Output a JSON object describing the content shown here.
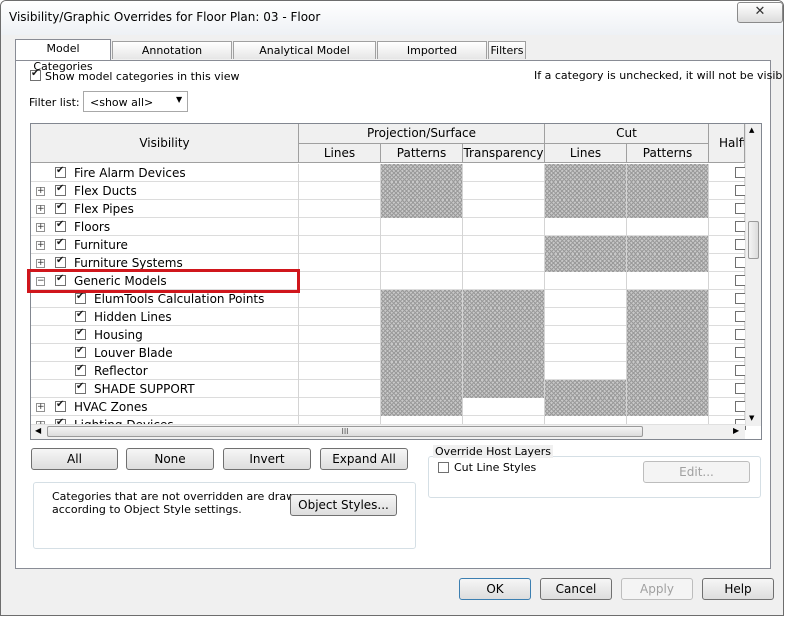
{
  "window": {
    "title": "Visibility/Graphic Overrides for Floor Plan: 03 - Floor",
    "close_glyph": "✕"
  },
  "tabs": [
    {
      "label": "Model Categories",
      "active": true
    },
    {
      "label": "Annotation Categories"
    },
    {
      "label": "Analytical Model Categories"
    },
    {
      "label": "Imported Categories"
    },
    {
      "label": "Filters"
    }
  ],
  "show_model": {
    "label": "Show model categories in this view",
    "checked": true
  },
  "hint": "If a category is unchecked, it will not be visible.",
  "filter": {
    "label": "Filter list:",
    "value": "<show all>"
  },
  "grid": {
    "headers": {
      "visibility": "Visibility",
      "projection": "Projection/Surface",
      "cut": "Cut",
      "halftone": "Halftone",
      "lines": "Lines",
      "patterns": "Patterns",
      "transparency": "Transparency",
      "cut_lines": "Lines",
      "cut_patterns": "Patterns"
    },
    "rows": [
      {
        "name": "Fire Alarm Devices",
        "level": 0,
        "expander": "",
        "checked": true,
        "hatch": [
          false,
          true,
          false,
          true,
          true
        ]
      },
      {
        "name": "Flex Ducts",
        "level": 0,
        "expander": "+",
        "checked": true,
        "hatch": [
          false,
          true,
          false,
          true,
          true
        ]
      },
      {
        "name": "Flex Pipes",
        "level": 0,
        "expander": "+",
        "checked": true,
        "hatch": [
          false,
          true,
          false,
          true,
          true
        ]
      },
      {
        "name": "Floors",
        "level": 0,
        "expander": "+",
        "checked": true,
        "hatch": [
          false,
          false,
          false,
          false,
          false
        ]
      },
      {
        "name": "Furniture",
        "level": 0,
        "expander": "+",
        "checked": true,
        "hatch": [
          false,
          false,
          false,
          true,
          true
        ]
      },
      {
        "name": "Furniture Systems",
        "level": 0,
        "expander": "+",
        "checked": true,
        "hatch": [
          false,
          false,
          false,
          true,
          true
        ]
      },
      {
        "name": "Generic Models",
        "level": 0,
        "expander": "−",
        "checked": true,
        "hatch": [
          false,
          false,
          false,
          false,
          false
        ]
      },
      {
        "name": "ElumTools Calculation Points",
        "level": 1,
        "expander": "",
        "checked": true,
        "hatch": [
          false,
          true,
          true,
          false,
          true
        ]
      },
      {
        "name": "Hidden Lines",
        "level": 1,
        "expander": "",
        "checked": true,
        "hatch": [
          false,
          true,
          true,
          false,
          true
        ]
      },
      {
        "name": "Housing",
        "level": 1,
        "expander": "",
        "checked": true,
        "hatch": [
          false,
          true,
          true,
          false,
          true
        ]
      },
      {
        "name": "Louver Blade",
        "level": 1,
        "expander": "",
        "checked": true,
        "hatch": [
          false,
          true,
          true,
          false,
          true
        ]
      },
      {
        "name": "Reflector",
        "level": 1,
        "expander": "",
        "checked": true,
        "hatch": [
          false,
          true,
          true,
          false,
          true
        ]
      },
      {
        "name": "SHADE SUPPORT",
        "level": 1,
        "expander": "",
        "checked": true,
        "hatch": [
          false,
          true,
          true,
          true,
          true
        ]
      },
      {
        "name": "HVAC Zones",
        "level": 0,
        "expander": "+",
        "checked": true,
        "hatch": [
          false,
          true,
          false,
          true,
          true
        ]
      },
      {
        "name": "Lighting Devices",
        "level": 0,
        "expander": "+",
        "checked": true,
        "hatch": [
          false,
          false,
          false,
          false,
          false
        ]
      }
    ]
  },
  "buttons": {
    "all": "All",
    "none": "None",
    "invert": "Invert",
    "expand_all": "Expand All",
    "object_styles": "Object Styles...",
    "edit": "Edit...",
    "ok": "OK",
    "cancel": "Cancel",
    "apply": "Apply",
    "help": "Help"
  },
  "note": {
    "line1": "Categories that are not overridden are drawn",
    "line2": "according to Object Style settings."
  },
  "override": {
    "title": "Override Host Layers",
    "cut_line_styles": "Cut Line Styles",
    "checked": false
  },
  "scroll_grip": "III",
  "colors": {
    "highlight": "#d0161c",
    "hatch": "#9a9a9a"
  }
}
